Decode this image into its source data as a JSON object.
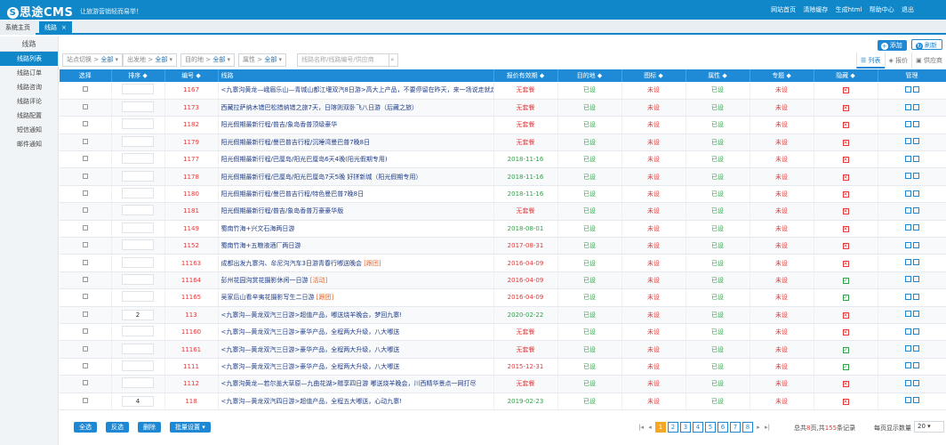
{
  "app": {
    "logo_text": "思途CMS",
    "slogan": "让旅游营销轻而易举！"
  },
  "toplinks": [
    "网站首页",
    "清除缓存",
    "生成html",
    "帮助中心",
    "退出"
  ],
  "tabs": {
    "home": "系统主页",
    "active": "线路",
    "close": "×"
  },
  "sidebar": {
    "title": "线路",
    "items": [
      "线路列表",
      "线路订单",
      "线路咨询",
      "线路评论",
      "线路配置",
      "短信通知",
      "邮件通知"
    ]
  },
  "actions": {
    "add": "添加",
    "refresh": "刷新"
  },
  "filters": {
    "station": {
      "label": "站点切换 >",
      "value": "全部"
    },
    "from": {
      "label": "出发地 >",
      "value": "全部"
    },
    "dest": {
      "label": "目的地 >",
      "value": "全部"
    },
    "attr": {
      "label": "属性 >",
      "value": "全部"
    },
    "search_placeholder": "线路名称/线路编号/供应商"
  },
  "view_tabs": [
    "列表",
    "报价",
    "供应商"
  ],
  "columns": [
    "选择",
    "排序",
    "编号",
    "线路",
    "报价有效期",
    "目的地",
    "图标",
    "属性",
    "专题",
    "隐藏",
    "管理"
  ],
  "rows": [
    {
      "sort": "",
      "id": "1167",
      "name": "<九寨沟黄龙—峨眉乐山—青城山都江堰双汽8日游>高大上产品，不要停留在昨天，来一场说走就走的旅行吧，超级旅游，行程全新景点。",
      "valid": "无套餐",
      "dest": "已设",
      "icon": "未设",
      "attr": "已设",
      "topic": "未设",
      "hidden": "x"
    },
    {
      "sort": "",
      "id": "1173",
      "name": "西藏拉萨纳木错巴松措纳错之旅7天，日喀则双卧飞八日游（后藏之旅）",
      "valid": "无套餐",
      "dest": "已设",
      "icon": "未设",
      "attr": "已设",
      "topic": "未设",
      "hidden": "x"
    },
    {
      "sort": "",
      "id": "1182",
      "name": "阳光假期最新行程/普吉/象岛香普顶级豪华",
      "valid": "无套餐",
      "dest": "已设",
      "icon": "未设",
      "attr": "已设",
      "topic": "未设",
      "hidden": "x"
    },
    {
      "sort": "",
      "id": "1179",
      "name": "阳光假期最新行程/曼巴普吉行程/沉睡湾曼巴普7晚8日",
      "valid": "无套餐",
      "dest": "已设",
      "icon": "未设",
      "attr": "已设",
      "topic": "未设",
      "hidden": "x"
    },
    {
      "sort": "",
      "id": "1177",
      "name": "阳光假期最新行程/巴厘岛/阳光巴厘岛6天4晚(阳光假期专用)",
      "valid": "2018-11-16",
      "dest": "已设",
      "icon": "未设",
      "attr": "已设",
      "topic": "未设",
      "hidden": "x"
    },
    {
      "sort": "",
      "id": "1178",
      "name": "阳光假期最新行程/巴厘岛/阳光巴厘岛7天5晚 好拼新城（阳光假期专用）",
      "valid": "2018-11-16",
      "dest": "已设",
      "icon": "未设",
      "attr": "已设",
      "topic": "未设",
      "hidden": "x"
    },
    {
      "sort": "",
      "id": "1180",
      "name": "阳光假期最新行程/曼巴普吉行程/特色曼巴普7晚8日",
      "valid": "2018-11-16",
      "dest": "已设",
      "icon": "未设",
      "attr": "已设",
      "topic": "未设",
      "hidden": "x"
    },
    {
      "sort": "",
      "id": "1181",
      "name": "阳光假期最新行程/普吉/象岛香普万豪豪华版",
      "valid": "无套餐",
      "dest": "已设",
      "icon": "未设",
      "attr": "已设",
      "topic": "未设",
      "hidden": "x"
    },
    {
      "sort": "",
      "id": "1149",
      "name": "蜀南竹海+兴文石海两日游",
      "valid": "2018-08-01",
      "dest": "已设",
      "icon": "未设",
      "attr": "已设",
      "topic": "未设",
      "hidden": "x"
    },
    {
      "sort": "",
      "id": "1152",
      "name": "蜀南竹海+五粮液酒厂两日游",
      "valid": "2017-08-31",
      "dest": "已设",
      "icon": "未设",
      "attr": "已设",
      "topic": "未设",
      "hidden": "x"
    },
    {
      "sort": "",
      "id": "11163",
      "name": "成都出发九寨沟、牟尼沟汽车3日游青春行嘟送晚会",
      "tag": "[跟团]",
      "valid": "2016-04-09",
      "dest": "已设",
      "icon": "未设",
      "attr": "已设",
      "topic": "未设",
      "hidden": "x"
    },
    {
      "sort": "",
      "id": "11164",
      "name": "彭州花园沟赏花摄影休闲一日游",
      "tag": "[活动]",
      "valid": "2016-04-09",
      "dest": "已设",
      "icon": "未设",
      "attr": "已设",
      "topic": "未设",
      "hidden": "v"
    },
    {
      "sort": "",
      "id": "11165",
      "name": "吴家后山看辛夷花摄影写生二日游",
      "tag": "[跟团]",
      "valid": "2016-04-09",
      "dest": "已设",
      "icon": "未设",
      "attr": "已设",
      "topic": "未设",
      "hidden": "v"
    },
    {
      "sort": "2",
      "id": "113",
      "name": "<九寨沟—黄龙双汽三日游>超值产品，嘟送烧羊晚会，梦回九寨!",
      "valid": "2020-02-22",
      "dest": "已设",
      "icon": "未设",
      "attr": "已设",
      "topic": "未设",
      "hidden": "x"
    },
    {
      "sort": "",
      "id": "11160",
      "name": "<九寨沟—黄龙双汽三日游>豪华产品，全程两大升级，八大嘟送",
      "valid": "无套餐",
      "dest": "已设",
      "icon": "未设",
      "attr": "已设",
      "topic": "未设",
      "hidden": "x"
    },
    {
      "sort": "",
      "id": "11161",
      "name": "<九寨沟—黄龙双汽三日游>豪华产品，全程两大升级，八大嘟送",
      "valid": "无套餐",
      "dest": "已设",
      "icon": "未设",
      "attr": "已设",
      "topic": "未设",
      "hidden": "v"
    },
    {
      "sort": "",
      "id": "1111",
      "name": "<九寨沟—黄龙双汽三日游>豪华产品，全程两大升级，八大嘟送",
      "valid": "2015-12-31",
      "dest": "已设",
      "icon": "未设",
      "attr": "已设",
      "topic": "未设",
      "hidden": "v"
    },
    {
      "sort": "",
      "id": "1112",
      "name": "<九寨沟黄龙—若尔盖大草原—九曲花湖>赠享四日游 嘟送烧羊晚会，川西精华景点一网打尽",
      "valid": "无套餐",
      "dest": "已设",
      "icon": "未设",
      "attr": "已设",
      "topic": "未设",
      "hidden": "x"
    },
    {
      "sort": "4",
      "id": "118",
      "name": "<九寨沟—黄龙双汽四日游>超值产品，全程五大嘟送，心动九寨!",
      "valid": "2019-02-23",
      "dest": "已设",
      "icon": "未设",
      "attr": "已设",
      "topic": "未设",
      "hidden": "x"
    }
  ],
  "bottom": {
    "select_all": "全选",
    "invert": "反选",
    "delete": "删除",
    "batch": "批量设置",
    "pages": [
      "1",
      "2",
      "3",
      "4",
      "5",
      "6",
      "7",
      "8"
    ],
    "current_page": "1",
    "info_prefix": "总共",
    "total_pages": "8",
    "info_mid": "页,共",
    "total_records": "155",
    "info_suffix": "条记录",
    "per_page_label": "每页显示数量",
    "per_page_value": "20"
  },
  "colors": {
    "primary": "#0f87c9",
    "table_header": "#1f8ad5",
    "red": "#e23b3b",
    "green": "#33a14a",
    "pager_current": "#f5a623"
  }
}
